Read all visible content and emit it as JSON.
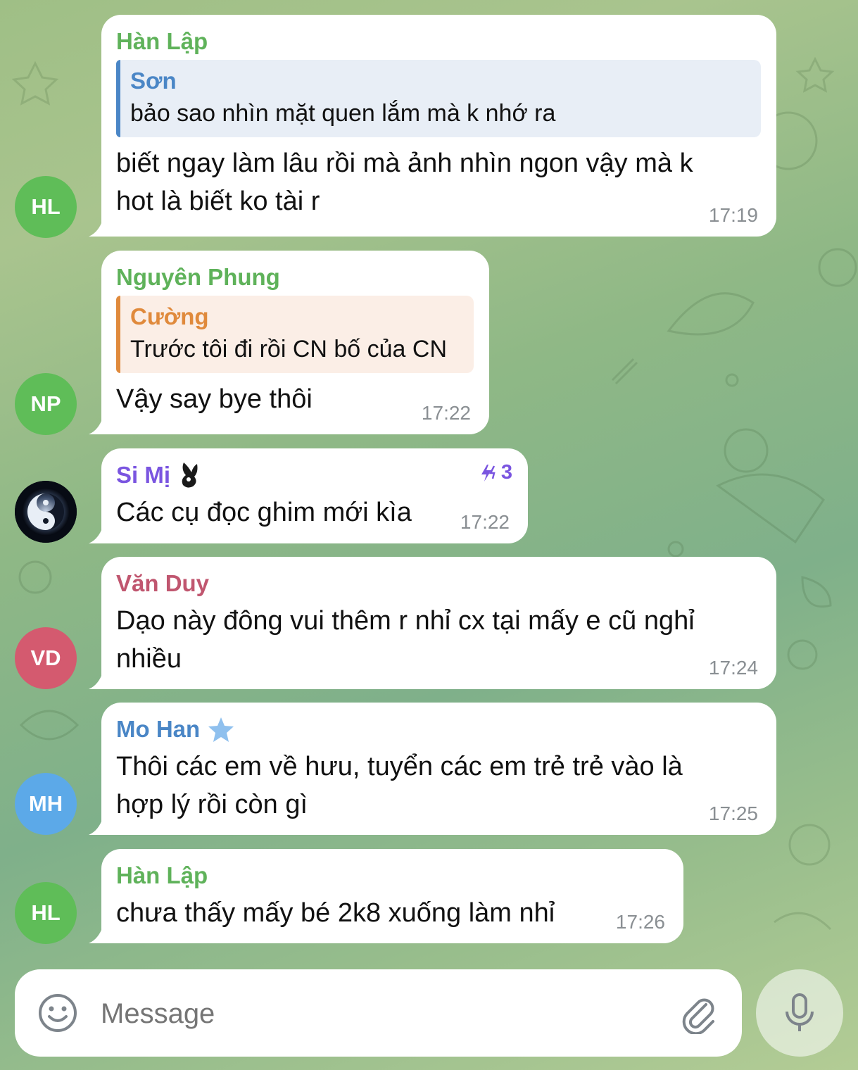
{
  "colors": {
    "green_name": "#5fb25a",
    "blue_name": "#4a86c6",
    "orange_name": "#e08a3c",
    "purple_name": "#7a55e0",
    "red_name": "#c0566f",
    "reply_blue_bg": "#e8eef6",
    "reply_orange_bg": "#fbeee6"
  },
  "messages": [
    {
      "avatar": "HL",
      "sender": "Hàn Lập",
      "reply": {
        "name": "Sơn",
        "text": "bảo sao nhìn mặt quen lắm mà k nhớ ra"
      },
      "lines": [
        "biết ngay làm lâu rồi mà ảnh nhìn ngon vậy mà k",
        "hot là biết ko tài r"
      ],
      "time": "17:19"
    },
    {
      "avatar": "NP",
      "sender": "Nguyên Phung",
      "reply": {
        "name": "Cường",
        "text": "Trước tôi đi rồi CN bố của CN"
      },
      "lines": [
        "Vậy say bye thôi"
      ],
      "time": "17:22"
    },
    {
      "avatar_icon": "yin-yang-avatar",
      "sender": "Si Mị",
      "sender_icon": "bunny-emoji-icon",
      "boost_icon": "boost-icon",
      "boost_count": "3",
      "lines": [
        "Các cụ đọc ghim mới kìa"
      ],
      "time": "17:22"
    },
    {
      "avatar": "VD",
      "sender": "Văn Duy",
      "lines": [
        "Dạo này đông vui thêm r nhỉ cx tại mấy e cũ nghỉ",
        "nhiều"
      ],
      "time": "17:24"
    },
    {
      "avatar": "MH",
      "sender": "Mo Han",
      "sender_icon": "star-icon",
      "lines": [
        "Thôi các em về hưu, tuyển các em trẻ trẻ vào là",
        "hợp lý rồi còn gì"
      ],
      "time": "17:25"
    },
    {
      "avatar": "HL",
      "sender": "Hàn Lập",
      "lines": [
        "chưa thấy mấy bé 2k8 xuống làm nhỉ"
      ],
      "time": "17:26"
    }
  ],
  "composer": {
    "placeholder": "Message",
    "emoji_icon": "emoji-icon",
    "attach_icon": "paperclip-icon",
    "mic_icon": "microphone-icon"
  }
}
